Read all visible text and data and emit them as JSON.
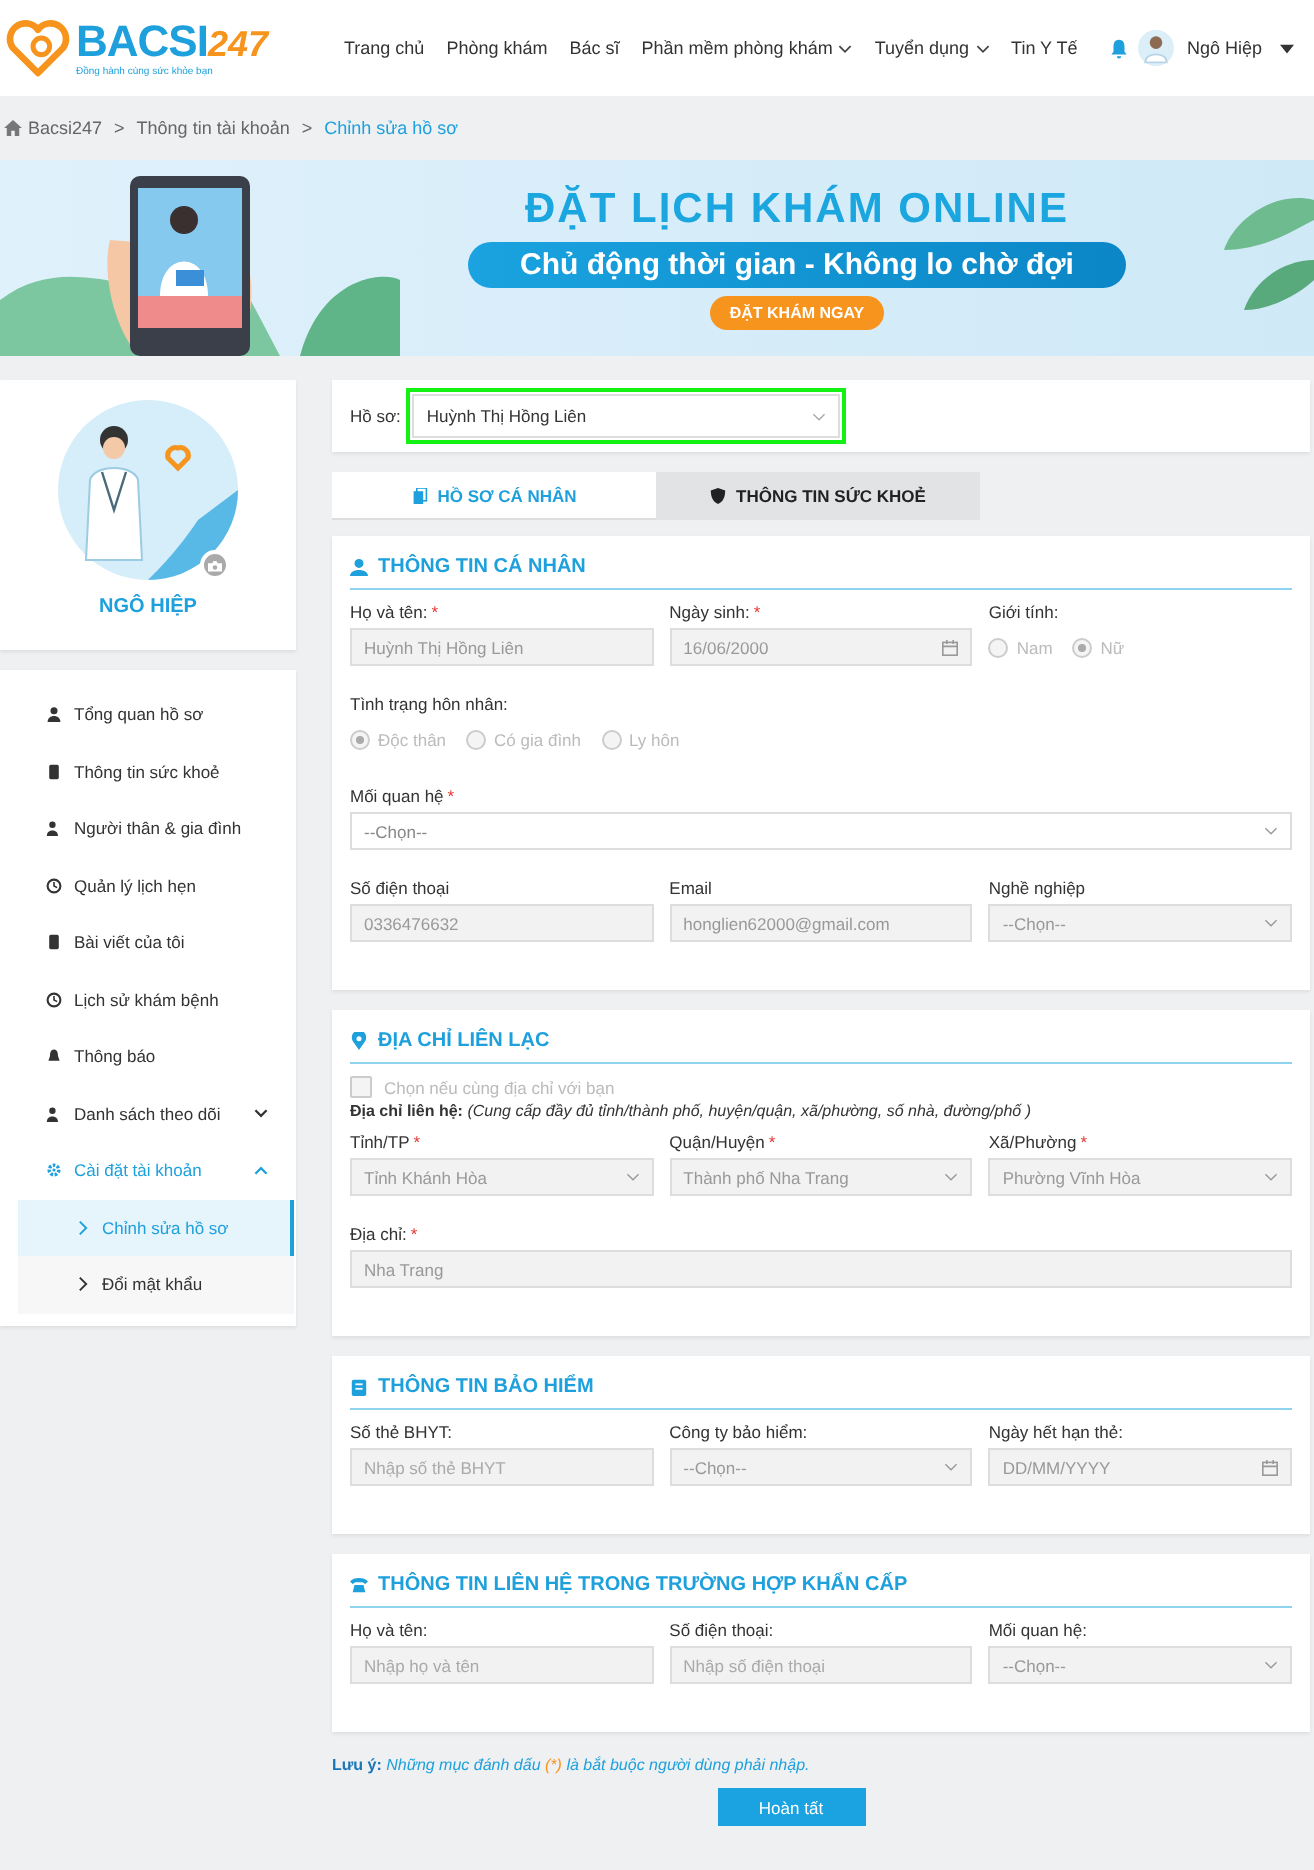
{
  "header": {
    "logo": {
      "text": "BACSI",
      "number": "247",
      "tagline": "Đồng hành cùng sức khỏe bạn"
    },
    "nav": [
      {
        "label": "Trang chủ",
        "dropdown": false
      },
      {
        "label": "Phòng khám",
        "dropdown": false
      },
      {
        "label": "Bác sĩ",
        "dropdown": false
      },
      {
        "label": "Phần mềm phòng khám",
        "dropdown": true
      },
      {
        "label": "Tuyển dụng",
        "dropdown": true
      },
      {
        "label": "Tin Y Tế",
        "dropdown": false
      }
    ],
    "user": {
      "name": "Ngô Hiệp"
    }
  },
  "breadcrumb": [
    {
      "label": "Bacsi247",
      "kind": "home"
    },
    {
      "label": ">",
      "kind": "sep"
    },
    {
      "label": "Thông tin tài khoản",
      "kind": "link"
    },
    {
      "label": ">",
      "kind": "sep"
    },
    {
      "label": "Chỉnh sửa hồ sơ",
      "kind": "current"
    }
  ],
  "banner": {
    "title": "ĐẶT LỊCH KHÁM ONLINE",
    "slogan": "Chủ động thời gian - Không lo chờ đợi",
    "button": "ĐẶT KHÁM NGAY"
  },
  "profile": {
    "name": "NGÔ HIỆP"
  },
  "menu": [
    {
      "label": "Tổng quan hồ sơ",
      "selected": false
    },
    {
      "label": "Thông tin sức khoẻ",
      "selected": false
    },
    {
      "label": "Người thân & gia đình",
      "selected": false
    },
    {
      "label": "Quản lý lịch hẹn",
      "selected": false
    },
    {
      "label": "Bài viết của tôi",
      "selected": false
    },
    {
      "label": "Lịch sử khám bệnh",
      "selected": false
    },
    {
      "label": "Thông báo",
      "selected": false
    },
    {
      "label": "Danh sách theo dõi",
      "selected": false,
      "expanded": false
    },
    {
      "label": "Cài đặt tài khoản",
      "selected": true,
      "expanded": true,
      "children": [
        {
          "label": "Chỉnh sửa hồ sơ",
          "selected": true
        },
        {
          "label": "Đổi mật khẩu",
          "selected": false
        }
      ]
    }
  ],
  "record": {
    "label": "Hồ sơ:",
    "value": "Huỳnh Thị Hồng Liên",
    "highlighted": true
  },
  "tabs": [
    {
      "label": "HỒ SƠ CÁ NHÂN",
      "selected": true
    },
    {
      "label": "THÔNG TIN SỨC KHOẺ",
      "selected": false
    }
  ],
  "sections": [
    {
      "title": "THÔNG TIN CÁ NHÂN",
      "rows": [
        [
          {
            "kind": "input",
            "label": "Họ và tên:",
            "mark": "*",
            "value": "Huỳnh Thị Hồng Liên",
            "disabled": true
          },
          {
            "kind": "date",
            "label": "Ngày sinh:",
            "mark": "*",
            "value": "16/06/2000",
            "disabled": true
          },
          {
            "kind": "radio",
            "label": "Giới tính:",
            "disabled": true,
            "options": [
              {
                "label": "Nam",
                "selected": false
              },
              {
                "label": "Nữ",
                "selected": true
              }
            ]
          }
        ],
        [
          {
            "kind": "radio",
            "label": "Tình trạng hôn nhân:",
            "disabled": true,
            "options": [
              {
                "label": "Độc thân",
                "selected": true
              },
              {
                "label": "Có gia đình",
                "selected": false
              },
              {
                "label": "Ly hôn",
                "selected": false
              }
            ]
          }
        ],
        [
          {
            "kind": "select",
            "label": "Mối quan hệ",
            "mark": "*",
            "placeholder": "--Chọn--",
            "disabled": false
          }
        ],
        [
          {
            "kind": "input",
            "label": "Số điện thoại",
            "value": "0336476632",
            "disabled": true
          },
          {
            "kind": "input",
            "label": "Email",
            "value": "honglien62000@gmail.com",
            "disabled": true
          },
          {
            "kind": "select",
            "label": "Nghề nghiệp",
            "placeholder": "--Chọn--",
            "disabled": true
          }
        ]
      ]
    },
    {
      "title": "ĐỊA CHỈ LIÊN LẠC",
      "same_address": {
        "label": "Chọn nếu cùng địa chỉ với bạn",
        "checked": false
      },
      "hint": "**Địa chỉ liên hệ:** *(Cung cấp đầy đủ tỉnh/thành phố, huyện/quận, xã/phường, số nhà, đường/phố )*",
      "rows": [
        [
          {
            "kind": "select",
            "label": "Tỉnh/TP",
            "mark": "*",
            "value": "Tỉnh Khánh Hòa",
            "disabled": true
          },
          {
            "kind": "select",
            "label": "Quận/Huyện",
            "mark": "*",
            "value": "Thành phố Nha Trang",
            "disabled": true
          },
          {
            "kind": "select",
            "label": "Xã/Phường",
            "mark": "*",
            "value": "Phường Vĩnh Hòa",
            "disabled": true
          }
        ],
        [
          {
            "kind": "input",
            "label": "Địa chỉ:",
            "mark": "*",
            "value": "Nha Trang",
            "disabled": true
          }
        ]
      ]
    },
    {
      "title": "THÔNG TIN BẢO HIỂM",
      "rows": [
        [
          {
            "kind": "input",
            "label": "Số thẻ BHYT:",
            "placeholder": "Nhập số thẻ BHYT",
            "disabled": true
          },
          {
            "kind": "select",
            "label": "Công ty bảo hiểm:",
            "placeholder": "--Chọn--",
            "disabled": true
          },
          {
            "kind": "date",
            "label": "Ngày hết hạn thẻ:",
            "placeholder": "DD/MM/YYYY",
            "disabled": true
          }
        ]
      ]
    },
    {
      "title": "THÔNG TIN LIÊN HỆ TRONG TRƯỜNG HỢP KHẨN CẤP",
      "rows": [
        [
          {
            "kind": "input",
            "label": "Họ và tên:",
            "placeholder": "Nhập họ và tên",
            "disabled": true
          },
          {
            "kind": "input",
            "label": "Số điện thoại:",
            "placeholder": "Nhập số điện thoại",
            "disabled": true
          },
          {
            "kind": "select",
            "label": "Mối quan hệ:",
            "placeholder": "--Chọn--",
            "disabled": true
          }
        ]
      ]
    }
  ],
  "note": {
    "label": "Lưu ý:",
    "before": "Những mục đánh dấu",
    "mark": "(*)",
    "after": "là bắt buộc người dùng phải nhập."
  },
  "submit": "Hoàn tất"
}
